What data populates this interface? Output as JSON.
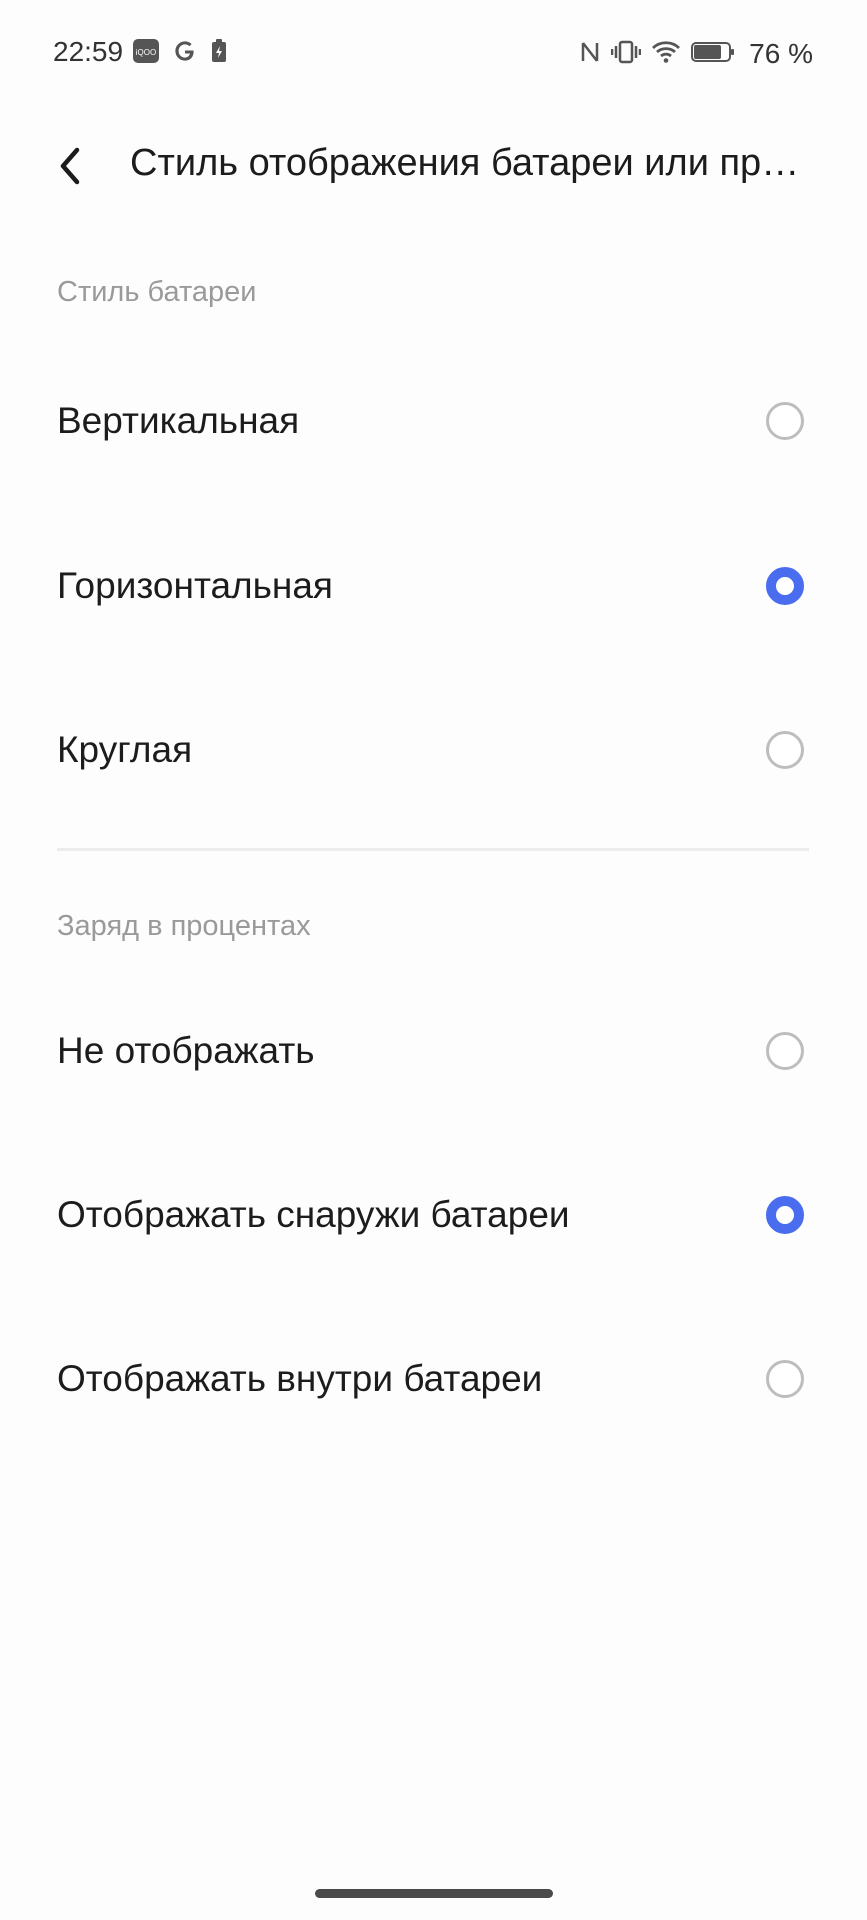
{
  "status_bar": {
    "time": "22:59",
    "battery_text": "76 %",
    "left_icons": [
      "iqoo-app-icon",
      "google-icon",
      "battery-saver-icon"
    ],
    "right_icons": [
      "nfc-icon",
      "vibrate-icon",
      "wifi-icon",
      "battery-icon"
    ]
  },
  "header": {
    "title": "Стиль отображения батареи или процентов заряда",
    "back_icon": "chevron-left-icon"
  },
  "sections": [
    {
      "label": "Стиль батареи",
      "options": [
        {
          "label": "Вертикальная",
          "selected": false
        },
        {
          "label": "Горизонтальная",
          "selected": true
        },
        {
          "label": "Круглая",
          "selected": false
        }
      ]
    },
    {
      "label": "Заряд в процентах",
      "options": [
        {
          "label": "Не отображать",
          "selected": false
        },
        {
          "label": "Отображать снаружи батареи",
          "selected": true
        },
        {
          "label": "Отображать внутри батареи",
          "selected": false
        }
      ]
    }
  ],
  "colors": {
    "accent": "#4a6df0",
    "radio_unchecked": "#bdbdbd",
    "section_label": "#9a9a9a",
    "text": "#1c1c1c"
  }
}
